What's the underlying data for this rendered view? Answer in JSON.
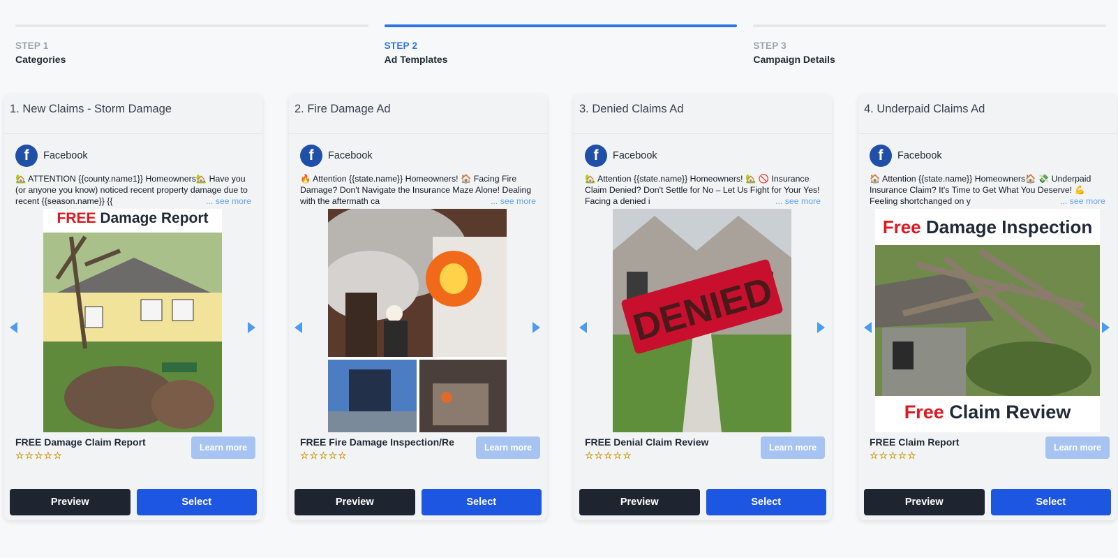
{
  "steps": [
    {
      "num": "STEP 1",
      "name": "Categories",
      "active": false
    },
    {
      "num": "STEP 2",
      "name": "Ad Templates",
      "active": true
    },
    {
      "num": "STEP 3",
      "name": "Campaign Details",
      "active": false
    }
  ],
  "cards": [
    {
      "title": "1. New Claims - Storm Damage",
      "platform": "Facebook",
      "text": "🏡 ATTENTION {{county.name1}} Homeowners🏡 Have you (or anyone you know) noticed recent property damage due to recent {{season.name}} {{",
      "see_more": "... see more",
      "banner_red": "FREE",
      "banner_black": " Damage Report",
      "headline": "FREE Damage Claim Report",
      "stars": "☆☆☆☆☆",
      "learn_more": "Learn more",
      "preview": "Preview",
      "select": "Select"
    },
    {
      "title": "2. Fire Damage Ad",
      "platform": "Facebook",
      "text": "🔥 Attention {{state.name}} Homeowners! 🏠 Facing Fire Damage? Don't Navigate the Insurance Maze Alone! Dealing with the aftermath ca",
      "see_more": "... see more",
      "headline": "FREE Fire Damage Inspection/Re",
      "stars": "☆☆☆☆☆",
      "learn_more": "Learn more",
      "preview": "Preview",
      "select": "Select"
    },
    {
      "title": "3. Denied Claims Ad",
      "platform": "Facebook",
      "text": "🏡 Attention {{state.name}} Homeowners! 🏡 🚫 Insurance Claim Denied? Don't Settle for No – Let Us Fight for Your Yes! Facing a denied i",
      "see_more": "... see more",
      "stamp": "DENIED",
      "headline": "FREE Denial Claim Review",
      "stars": "☆☆☆☆☆",
      "learn_more": "Learn more",
      "preview": "Preview",
      "select": "Select"
    },
    {
      "title": "4. Underpaid Claims Ad",
      "platform": "Facebook",
      "text": "🏠 Attention {{state.name}} Homeowners🏠 💸 Underpaid Insurance Claim? It's Time to Get What You Deserve! 💪 Feeling shortchanged on y",
      "see_more": "... see more",
      "banner_top_red": "Free",
      "banner_top_black": " Damage Inspection",
      "banner_bottom_red": "Free",
      "banner_bottom_black": " Claim Review",
      "headline": "FREE Claim Report",
      "stars": "☆☆☆☆☆",
      "learn_more": "Learn more",
      "preview": "Preview",
      "select": "Select"
    }
  ],
  "colors": {
    "accent": "#2f74e4",
    "select": "#1d56e0",
    "preview": "#1f2530",
    "learn_more": "#a6c3f2"
  },
  "icons": {
    "platform": "facebook-icon",
    "prev": "caret-left-icon",
    "next": "caret-right-icon"
  }
}
